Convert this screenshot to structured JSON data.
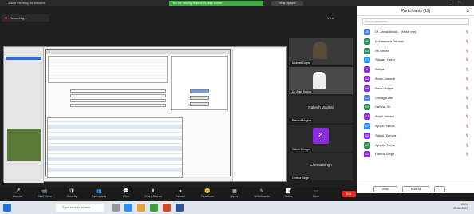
{
  "window": {
    "title": "Zoom Meeting 40-Minutes"
  },
  "share_banner": "You are viewing Mukesh Gupta's screen",
  "view_options": "View Options",
  "recording_label": "Recording...",
  "view_label": "View",
  "video_tiles": [
    {
      "name": "Mukesh Gupta"
    },
    {
      "name": "Dr. Ankit Kumar"
    },
    {
      "name": "Rakesh Mughal",
      "big_name": "Rakesh Mughal"
    },
    {
      "name": "Saloni Dhingra",
      "avatar": "a"
    },
    {
      "name": "Chetna Singh",
      "big_name": "Chetna Singh"
    }
  ],
  "participants": {
    "header": "Participants (19)",
    "search_placeholder": "Find a participant",
    "list": [
      {
        "initial": "JA",
        "name": "Dr. Jamal Abdul... (Host, me)",
        "color": "#4a7fd4"
      },
      {
        "initial": "MR",
        "name": "Mohammed Rehaan",
        "color": "#2e8b57"
      },
      {
        "initial": "SS",
        "name": "SS Mehta",
        "color": "#2e8b57"
      },
      {
        "initial": "SY",
        "name": "Shivam Yadav",
        "color": "#1e90ff"
      },
      {
        "initial": "A",
        "name": "Aditya",
        "color": "#8a2be2"
      },
      {
        "initial": "AJ",
        "name": "Aman Jaiswal",
        "color": "#8a2be2"
      },
      {
        "initial": "AB",
        "name": "Arnav Bagrat",
        "color": "#8a2be2"
      },
      {
        "initial": "CK",
        "name": "Chirag Khan",
        "color": "#4a7fd4"
      },
      {
        "initial": "HS",
        "name": "Harsha Jin",
        "color": "#2e8b57"
      },
      {
        "initial": "AJ",
        "name": "Anjali Jaiswal",
        "color": "#8a2be2"
      },
      {
        "initial": "AP",
        "name": "Ayush Pathak",
        "color": "#1e90ff"
      },
      {
        "initial": "SD",
        "name": "Saloni Dhingra",
        "color": "#8a2be2"
      },
      {
        "initial": "AT",
        "name": "Ayusha Tomar",
        "color": "#2e8b57"
      },
      {
        "initial": "CS",
        "name": "Chetna Singh",
        "color": "#8a2be2"
      }
    ],
    "invite": "Invite",
    "mute_all": "Mute All",
    "more": "..."
  },
  "toolbar": {
    "items": [
      {
        "icon": "🎤",
        "label": "Unmute"
      },
      {
        "icon": "📹",
        "label": "Start Video"
      },
      {
        "icon": "🛡",
        "label": "Security"
      },
      {
        "icon": "👥",
        "label": "Participants"
      },
      {
        "icon": "💬",
        "label": "Chat"
      },
      {
        "icon": "⬆",
        "label": "Share Screen"
      },
      {
        "icon": "⏺",
        "label": "Record"
      },
      {
        "icon": "😊",
        "label": "Reactions"
      },
      {
        "icon": "▦",
        "label": "Apps"
      },
      {
        "icon": "✎",
        "label": "Whiteboards"
      },
      {
        "icon": "📝",
        "label": "Notes"
      },
      {
        "icon": "⋯",
        "label": "More"
      }
    ],
    "end": "End"
  },
  "taskbar": {
    "search": "Type here to search",
    "time": "10:24",
    "date": "21-06-2022"
  }
}
